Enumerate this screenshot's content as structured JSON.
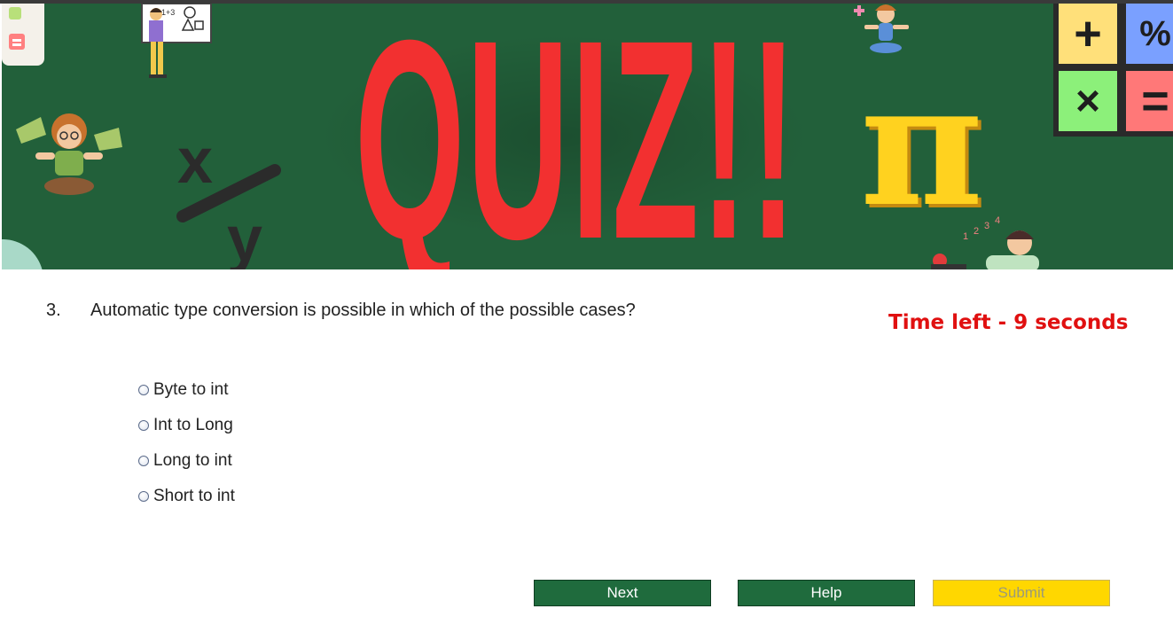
{
  "banner": {
    "title": "QUIZ!!",
    "math_tiles": [
      "+",
      "%",
      "×",
      "="
    ],
    "colors": {
      "background": "#22603a",
      "title": "#f23030"
    },
    "decorative_icons": [
      "teacher-whiteboard-icon",
      "child-icon",
      "girl-icon",
      "boy-reading-icon",
      "pi-symbol-icon",
      "fraction-symbol-icon"
    ],
    "decorative_text": {
      "fraction": "x/y",
      "pi": "π",
      "whiteboard": "1+3",
      "counting": "1 2 3 4"
    }
  },
  "question": {
    "number": "3.",
    "text": "Automatic type conversion is possible in which of the possible cases?"
  },
  "timer": {
    "text": "Time left - 9 seconds",
    "color": "#e01010"
  },
  "options": [
    {
      "label": "Byte to int",
      "selected": false
    },
    {
      "label": "Int to Long",
      "selected": false
    },
    {
      "label": "Long to int",
      "selected": false
    },
    {
      "label": "Short to int",
      "selected": false
    }
  ],
  "buttons": {
    "next": "Next",
    "help": "Help",
    "submit": "Submit"
  }
}
